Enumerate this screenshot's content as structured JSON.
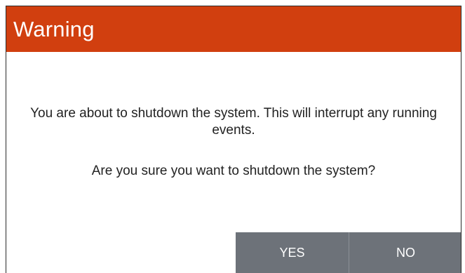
{
  "dialog": {
    "title": "Warning",
    "message": "You are about to shutdown the system. This will interrupt any running events.",
    "question": "Are you sure you want to shutdown the system?",
    "buttons": {
      "yes_label": "YES",
      "no_label": "NO"
    }
  },
  "colors": {
    "title_bar": "#d13f0f",
    "title_text": "#ffffff",
    "button_bg": "#6d7279",
    "button_text": "#ffffff",
    "body_text": "#222222"
  }
}
